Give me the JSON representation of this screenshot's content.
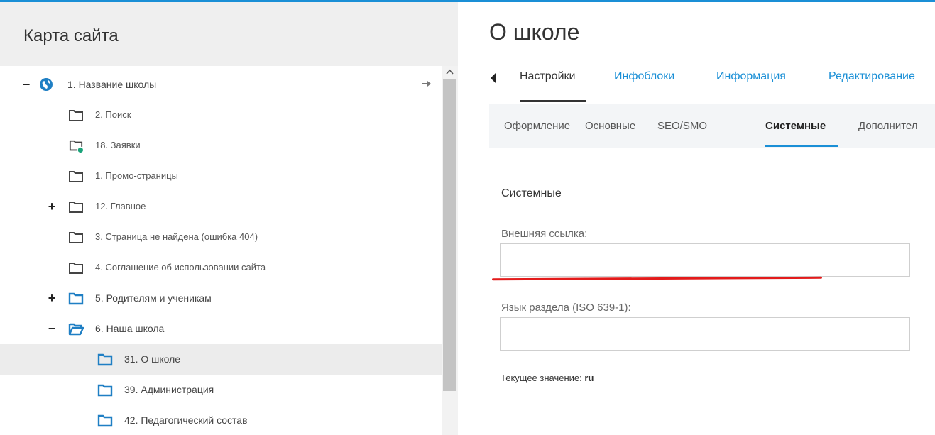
{
  "sitemap": {
    "title": "Карта сайта",
    "items": [
      {
        "label": "1. Название школы",
        "toggle": "−",
        "icon": "globe"
      },
      {
        "label": "2. Поиск",
        "toggle": "",
        "icon": "folder"
      },
      {
        "label": "18. Заявки",
        "toggle": "",
        "icon": "folder-status"
      },
      {
        "label": "1. Промо-страницы",
        "toggle": "",
        "icon": "folder"
      },
      {
        "label": "12. Главное",
        "toggle": "+",
        "icon": "folder"
      },
      {
        "label": "3. Страница не найдена (ошибка 404)",
        "toggle": "",
        "icon": "folder"
      },
      {
        "label": "4. Соглашение об использовании сайта",
        "toggle": "",
        "icon": "folder"
      },
      {
        "label": "5. Родителям и ученикам",
        "toggle": "+",
        "icon": "folder-blue"
      },
      {
        "label": "6. Наша школа",
        "toggle": "−",
        "icon": "folder-open-blue"
      },
      {
        "label": "31. О школе",
        "toggle": "",
        "icon": "folder-blue"
      },
      {
        "label": "39. Администрация",
        "toggle": "",
        "icon": "folder-blue"
      },
      {
        "label": "42. Педагогический состав",
        "toggle": "",
        "icon": "folder-blue"
      }
    ]
  },
  "page": {
    "title": "О школе",
    "tabs": [
      "Настройки",
      "Инфоблоки",
      "Информация",
      "Редактирование"
    ],
    "subtabs": [
      "Оформление",
      "Основные",
      "SEO/SMO",
      "Системные",
      "Дополнител"
    ],
    "section_title": "Системные",
    "external_link": {
      "label": "Внешняя ссылка:",
      "value": ""
    },
    "language": {
      "label": "Язык раздела (ISO 639-1):",
      "value": ""
    },
    "current_value": {
      "label": "Текущее значение:",
      "value": "ru"
    }
  },
  "colors": {
    "accent": "#1a8fd6",
    "folder_blue": "#1f7fc4",
    "folder_gray": "#444444",
    "status_green": "#1aa37a",
    "annotation_red": "#e31b1b"
  }
}
